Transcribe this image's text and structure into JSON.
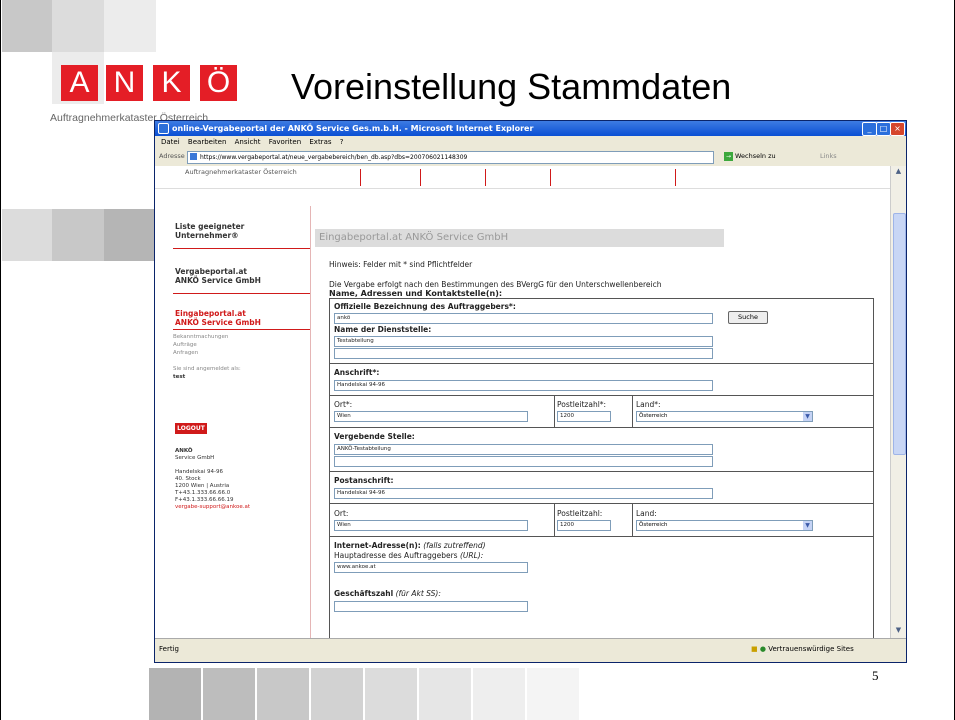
{
  "slide": {
    "logo_letters": [
      "A",
      "N",
      "K",
      "Ö"
    ],
    "logo_subtitle": "Auftragnehmerkataster Österreich",
    "title": "Voreinstellung Stammdaten",
    "page_number": "5",
    "accent": "#e41e26"
  },
  "browser": {
    "title": "online-Vergabeportal der ANKÖ Service Ges.m.b.H. - Microsoft Internet Explorer",
    "menu": [
      "Datei",
      "Bearbeiten",
      "Ansicht",
      "Favoriten",
      "Extras",
      "?"
    ],
    "address_label": "Adresse",
    "url": "https://www.vergabeportal.at/neue_vergabebereich/ben_db.asp?dbs=200706021148309",
    "go_label": "Wechseln zu",
    "links_label": "Links",
    "status_left": "Fertig",
    "status_right": "Vertrauenswürdige Sites"
  },
  "page": {
    "header_crumb": "Auftragnehmerkataster Österreich",
    "nav": [
      {
        "label": "Liste geeigneter Unternehmer®"
      },
      {
        "label": "Vergabeportal.at ANKÖ Service GmbH"
      },
      {
        "label": "Eingabeportal.at ANKÖ Service GmbH"
      }
    ],
    "nav_sub": [
      "Bekanntmachungen",
      "Aufträge",
      "Anfragen",
      "",
      "Sie sind angemeldet als:",
      "test"
    ],
    "logout": "LOGOUT",
    "contact": [
      "ANKÖ",
      "Service GmbH",
      "",
      "Handelskai 94-96",
      "40. Stock",
      "1200 Wien | Austria",
      "T+43.1.333.66.66.0",
      "F+43.1.333.66.66.19",
      "vergabe-support@ankoe.at"
    ],
    "portal_title": "Eingabeportal.at ANKÖ Service GmbH",
    "hint": "Hinweis: Felder mit * sind Pflichtfelder",
    "intro": "Die Vergabe erfolgt nach den Bestimmungen des BVergG für den Unterschwellenbereich",
    "section": "Name, Adressen und Kontaktstelle(n):"
  },
  "form": {
    "official_label": "Offizielle Bezeichnung des Auftraggebers*:",
    "official_value": "ankö",
    "search_button": "Suche",
    "dept_label": "Name der Dienststelle:",
    "dept_value": "Testabteilung",
    "address_label": "Anschrift*:",
    "address_value": "Handelskai 94-96",
    "city_label": "Ort*:",
    "city_value": "Wien",
    "zip_label": "Postleitzahl*:",
    "zip_value": "1200",
    "country_label": "Land*:",
    "country_value": "Österreich",
    "awarding_label": "Vergebende Stelle:",
    "awarding_value": "ANKÖ-Testabteilung",
    "postal_label": "Postanschrift:",
    "postal_value": "Handelskai 94-96",
    "city2_label": "Ort:",
    "city2_value": "Wien",
    "zip2_label": "Postleitzahl:",
    "zip2_value": "1200",
    "country2_label": "Land:",
    "country2_value": "Österreich",
    "internet_label": "Internet-Adresse(n):",
    "internet_note": "(falls zutreffend)",
    "main_url_label": "Hauptadresse des Auftraggebers",
    "main_url_note": "(URL):",
    "main_url_value": "www.ankoe.at",
    "file_label": "Geschäftszahl",
    "file_note": "(für Akt SS):",
    "file_value": ""
  }
}
